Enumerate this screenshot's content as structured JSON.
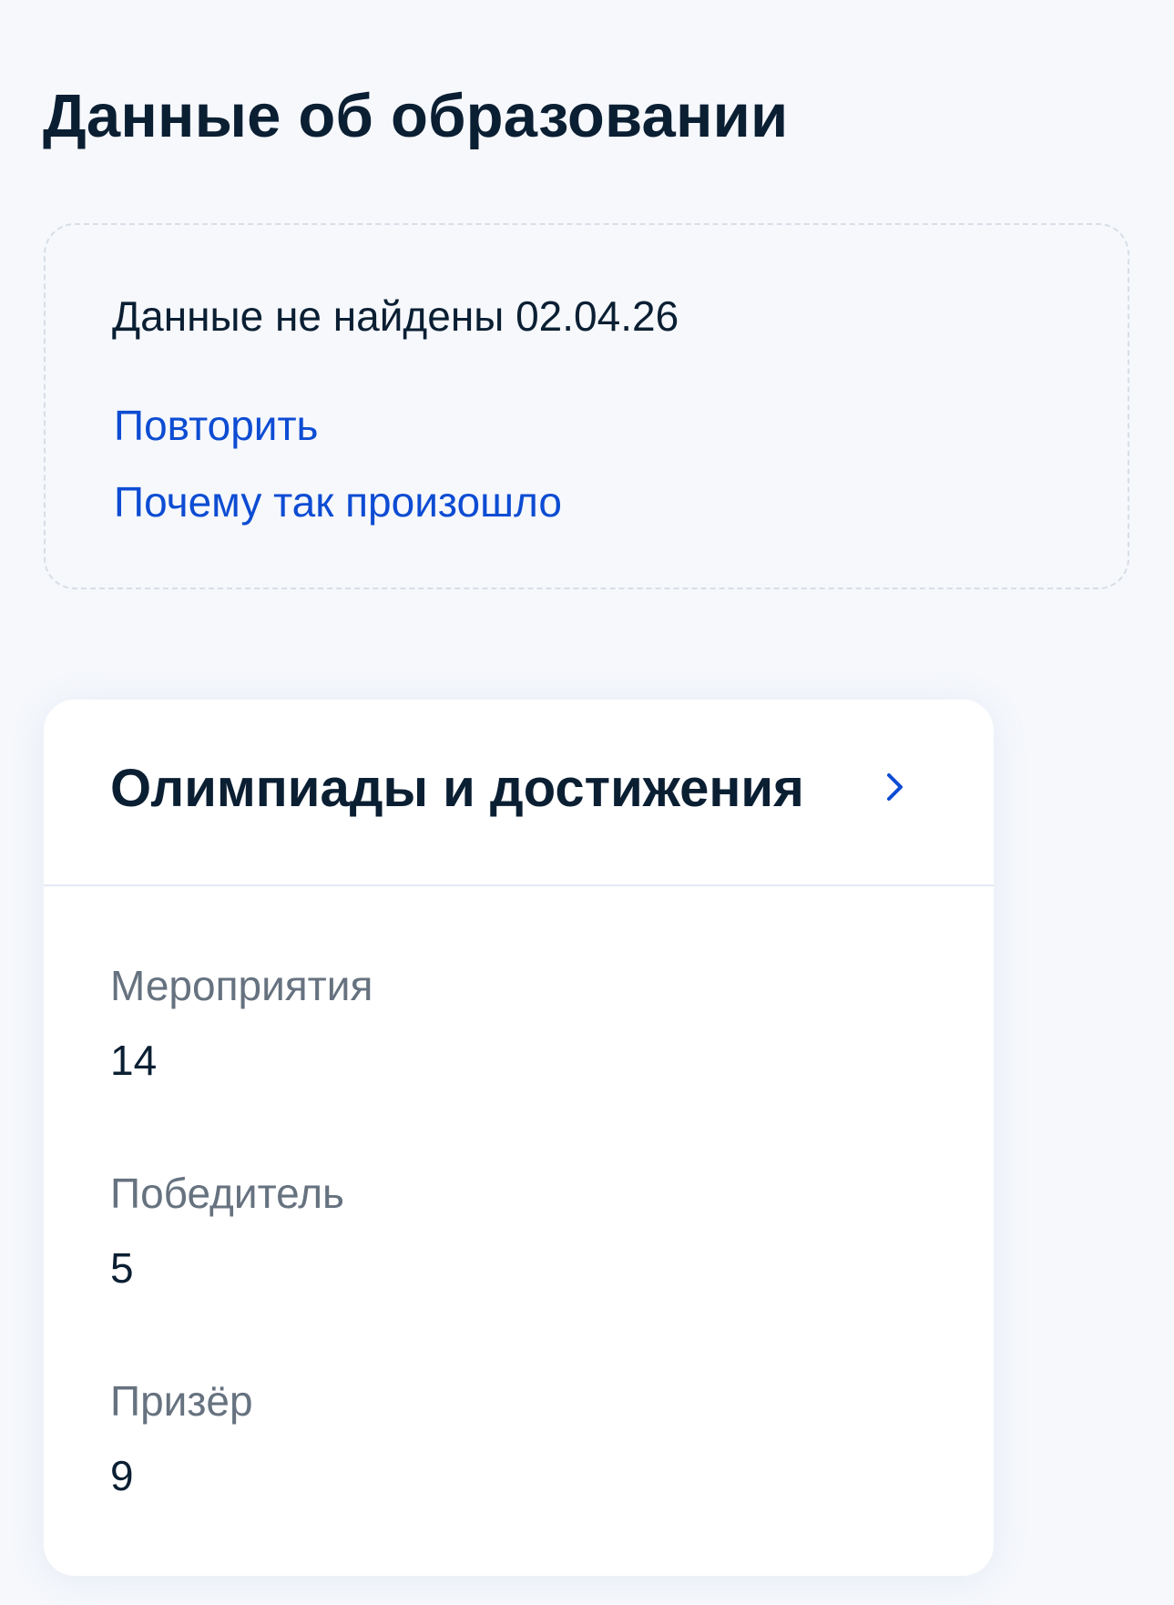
{
  "page": {
    "title": "Данные об образовании"
  },
  "notice": {
    "text": "Данные не найдены 02.04.26",
    "retry_label": "Повторить",
    "why_label": "Почему так произошло"
  },
  "achievements": {
    "title": "Олимпиады и достижения",
    "chevron_icon": "chevron-right-icon",
    "stats": [
      {
        "label": "Мероприятия",
        "value": "14"
      },
      {
        "label": "Победитель",
        "value": "5"
      },
      {
        "label": "Призёр",
        "value": "9"
      }
    ]
  },
  "colors": {
    "background": "#f6f8fc",
    "text_primary": "#0b1f33",
    "text_secondary": "#66727f",
    "link": "#0d4cd3",
    "card": "#ffffff"
  }
}
